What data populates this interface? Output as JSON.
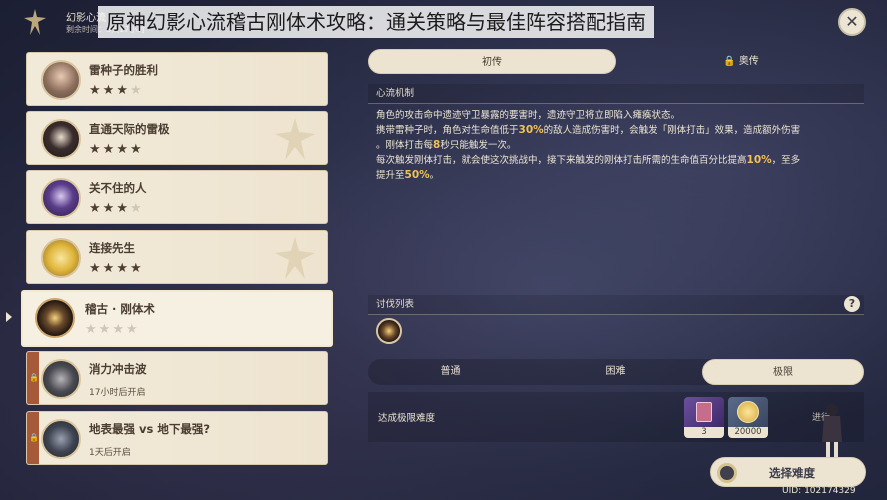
{
  "overlay_title": "原神幻影心流稽古刚体术攻略：通关策略与最佳阵容搭配指南",
  "event": {
    "name": "幻影心流",
    "remaining": "剩余时间：3天17小时"
  },
  "challenges": [
    {
      "name": "雷种子的胜利",
      "stars_filled": 3,
      "stars_total": 4,
      "locked": false
    },
    {
      "name": "直通天际的雷极",
      "stars_filled": 4,
      "stars_total": 4,
      "locked": false
    },
    {
      "name": "关不住的人",
      "stars_filled": 3,
      "stars_total": 4,
      "locked": false
    },
    {
      "name": "连接先生",
      "stars_filled": 4,
      "stars_total": 4,
      "locked": false
    },
    {
      "name": "稽古 · 刚体术",
      "stars_filled": 0,
      "stars_total": 4,
      "locked": false,
      "selected": true
    },
    {
      "name": "消力冲击波",
      "sub": "17小时后开启",
      "locked": true
    },
    {
      "name": "地表最强 vs 地下最强?",
      "sub": "1天后开启",
      "locked": true
    }
  ],
  "tabs": {
    "active": "初传",
    "locked": "奥传",
    "lock_icon": "lock-icon"
  },
  "mechanism": {
    "title": "心流机制",
    "line1": "角色的攻击命中遗迹守卫暴露的要害时，遗迹守卫将立即陷入瘫痪状态。",
    "line2a": "携带雷种子时，角色对生命值低于",
    "line2_highlight": "30%",
    "line2b": "的敌人造成伤害时，会触发「刚体打击」效果，造成额外伤害",
    "line3a": "。刚体打击每",
    "line3_highlight": "8",
    "line3b": "秒只能触发一次。",
    "line4a": "每次触发刚体打击，就会使这次挑战中，接下来触发的刚体打击所需的生命值百分比提高",
    "line4_highlight": "10%",
    "line4b": "，至多",
    "line5a": "提升至",
    "line5_highlight": "50%",
    "line5b": "。"
  },
  "enemy_list": {
    "title": "讨伐列表",
    "help": "?"
  },
  "difficulty": {
    "tabs": [
      "普通",
      "困难",
      "极限"
    ],
    "active_index": 2
  },
  "reward": {
    "label": "达成极限难度",
    "items": [
      {
        "icon": "book-icon",
        "count": "3"
      },
      {
        "icon": "mora-coin-icon",
        "count": "20000"
      }
    ],
    "partial_text": "进行"
  },
  "select_button": "选择难度",
  "uid": "UID: 102174329",
  "colors": {
    "highlight": "#f1c257",
    "panel": "#ece4d1",
    "locked_strip": "#a65a3a"
  }
}
